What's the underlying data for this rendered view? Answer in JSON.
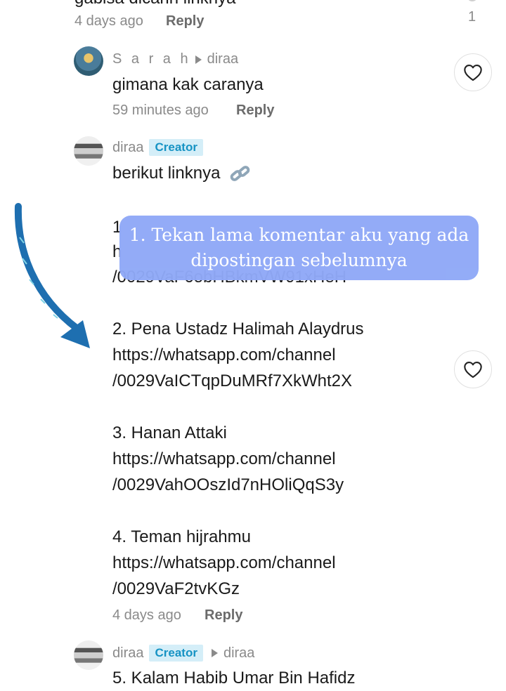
{
  "top": {
    "cut_text": "gabisa dicarin linknya",
    "time": "4 days ago",
    "reply_label": "Reply",
    "like_count": "1"
  },
  "comment_sarah": {
    "username": "S a r a h",
    "reply_to": "diraa",
    "text": "gimana kak caranya",
    "time": "59 minutes ago",
    "reply_label": "Reply"
  },
  "comment_diraa": {
    "username": "diraa",
    "badge": "Creator",
    "intro": "berikut linknya",
    "hidden_partial_lines": [
      "1",
      "h",
      "/0029VaF6obHBkmVW91xHeH"
    ],
    "lines": [
      "2. Pena Ustadz Halimah Alaydrus",
      "https://whatsapp.com/channel",
      "/0029VaICTqpDuMRf7XkWht2X",
      "3. Hanan Attaki",
      "https://whatsapp.com/channel",
      "/0029VahOOszId7nHOliQqS3y",
      "4. Teman hijrahmu",
      "https://whatsapp.com/channel",
      "/0029VaF2tvKGz"
    ],
    "time": "4 days ago",
    "reply_label": "Reply"
  },
  "comment_bottom": {
    "username": "diraa",
    "badge": "Creator",
    "reply_to": "diraa",
    "cut_text": "5. Kalam Habib Umar Bin Hafidz"
  },
  "overlay": {
    "line1": "1. Tekan lama komentar aku yang ada",
    "line2": "dipostingan sebelumnya"
  },
  "icons": {
    "heart": "heart-outline-icon",
    "link": "link-emoji-icon",
    "arrow": "curved-arrow-icon",
    "reply_to": "triangle-right-icon"
  },
  "colors": {
    "badge_bg": "#d4eef8",
    "badge_text": "#1693c4",
    "overlay_bg": "#90a9f7",
    "arrow": "#1e6fb0"
  }
}
